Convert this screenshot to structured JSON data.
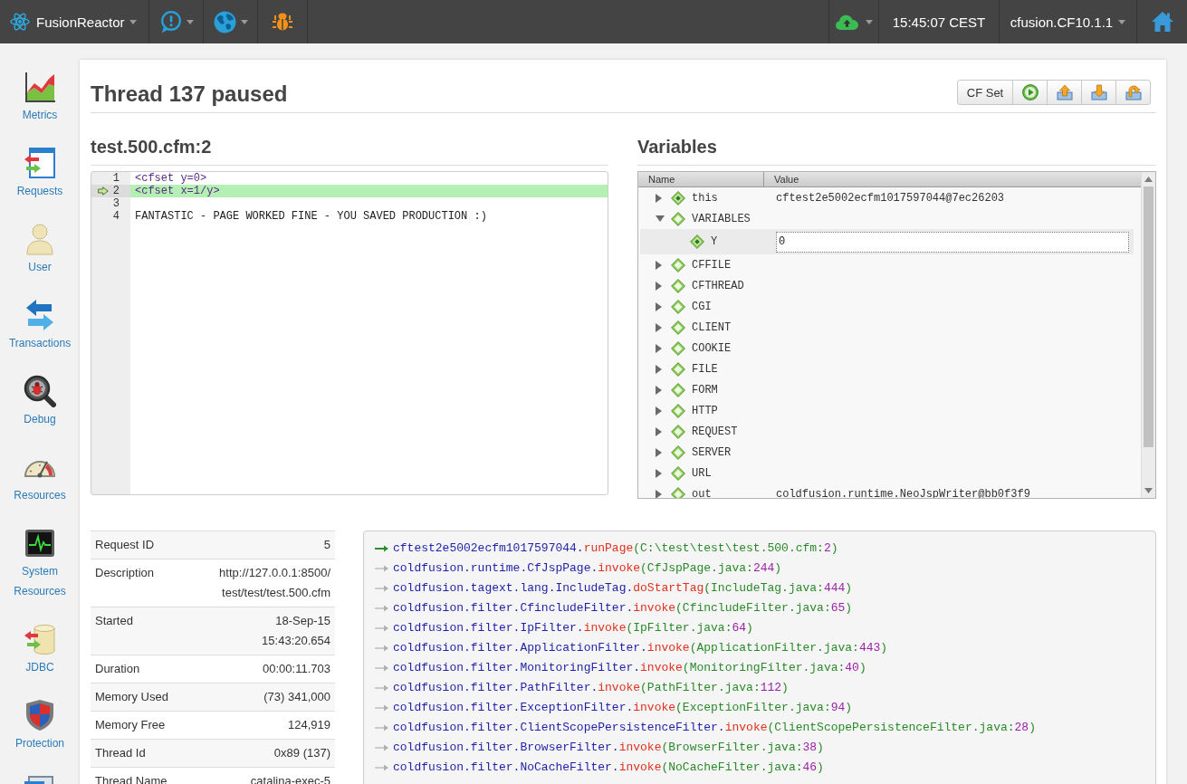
{
  "navbar": {
    "left": [
      {
        "kind": "brand",
        "label": "FusionReactor",
        "dropdown": true
      },
      {
        "kind": "alerts",
        "dropdown": true
      },
      {
        "kind": "globe",
        "dropdown": true
      },
      {
        "kind": "bug",
        "dropdown": false
      }
    ],
    "right": [
      {
        "kind": "cloud",
        "dropdown": true
      },
      {
        "kind": "time",
        "label": "15:45:07 CEST",
        "dropdown": false
      },
      {
        "kind": "server",
        "label": "cfusion.CF10.1.1",
        "dropdown": true
      },
      {
        "kind": "home",
        "dropdown": false
      }
    ]
  },
  "sidebar": {
    "items": [
      {
        "kind": "metrics",
        "label": "Metrics"
      },
      {
        "kind": "requests",
        "label": "Requests"
      },
      {
        "kind": "user",
        "label": "User"
      },
      {
        "kind": "transactions",
        "label": "Transactions"
      },
      {
        "kind": "debug",
        "label": "Debug"
      },
      {
        "kind": "resources",
        "label": "Resources"
      },
      {
        "kind": "system",
        "label": "System Resources"
      },
      {
        "kind": "jdbc",
        "label": "JDBC"
      },
      {
        "kind": "protection",
        "label": "Protection"
      },
      {
        "kind": "window"
      }
    ]
  },
  "page": {
    "title": "Thread 137 paused",
    "toolbar": [
      {
        "kind": "text",
        "label": "CF Set"
      },
      {
        "kind": "resume"
      },
      {
        "kind": "step-out"
      },
      {
        "kind": "step-into"
      },
      {
        "kind": "step-over"
      }
    ]
  },
  "source": {
    "title": "test.500.cfm:2",
    "lines": [
      {
        "number": "1",
        "text": "<cfset y=0>",
        "kind": "tag",
        "current": false
      },
      {
        "number": "2",
        "text": "<cfset x=1/y>",
        "kind": "tag",
        "current": true
      },
      {
        "number": "3",
        "kind": "text",
        "current": false
      },
      {
        "number": "4",
        "text": "FANTASTIC - PAGE WORKED FINE - YOU SAVED PRODUCTION :)",
        "kind": "text",
        "current": false
      }
    ]
  },
  "variables": {
    "title": "Variables",
    "columns": [
      "Name",
      "Value"
    ],
    "nodes": [
      {
        "name": "this",
        "kind": "object",
        "value": "cftest2e5002ecfm1017597044@7ec26203",
        "expanded": false,
        "selected": false
      },
      {
        "name": "VARIABLES",
        "kind": "scope",
        "expanded": true,
        "selected": false,
        "children": [
          {
            "name": "Y",
            "kind": "object",
            "value": "0",
            "selected": true
          }
        ]
      },
      {
        "name": "CFFILE",
        "kind": "scope",
        "expanded": false,
        "selected": false
      },
      {
        "name": "CFTHREAD",
        "kind": "scope",
        "expanded": false,
        "selected": false
      },
      {
        "name": "CGI",
        "kind": "scope",
        "expanded": false,
        "selected": false
      },
      {
        "name": "CLIENT",
        "kind": "scope",
        "expanded": false,
        "selected": false
      },
      {
        "name": "COOKIE",
        "kind": "scope",
        "expanded": false,
        "selected": false
      },
      {
        "name": "FILE",
        "kind": "scope",
        "expanded": false,
        "selected": false
      },
      {
        "name": "FORM",
        "kind": "scope",
        "expanded": false,
        "selected": false
      },
      {
        "name": "HTTP",
        "kind": "scope",
        "expanded": false,
        "selected": false
      },
      {
        "name": "REQUEST",
        "kind": "scope",
        "expanded": false,
        "selected": false
      },
      {
        "name": "SERVER",
        "kind": "scope",
        "expanded": false,
        "selected": false
      },
      {
        "name": "URL",
        "kind": "scope",
        "expanded": false,
        "selected": false
      },
      {
        "name": "out",
        "kind": "scope",
        "value": "coldfusion.runtime.NeoJspWriter@bb0f3f9",
        "expanded": false,
        "selected": false
      }
    ]
  },
  "request_info": {
    "rows": [
      {
        "label": "Request ID",
        "value": "5"
      },
      {
        "label": "Description",
        "value_lines": [
          "http://127.0.0.1:8500/",
          "test/test/test.500.cfm"
        ]
      },
      {
        "label": "Started",
        "value_lines": [
          "18-Sep-15",
          "15:43:20.654"
        ]
      },
      {
        "label": "Duration",
        "value": "00:00:11.703"
      },
      {
        "label": "Memory Used",
        "value": "(73) 341,000"
      },
      {
        "label": "Memory Free",
        "value": "124,919"
      },
      {
        "label": "Thread Id",
        "value": "0x89 (137)"
      },
      {
        "label": "Thread Name",
        "value": "catalina-exec-5"
      }
    ]
  },
  "stack_trace": {
    "frames": [
      {
        "current": true,
        "class": "cftest2e5002ecfm1017597044.",
        "method": "runPage",
        "source": "(C:\\test\\test\\test.500.cfm:",
        "line": "2",
        "end": ")"
      },
      {
        "current": false,
        "class": "coldfusion.runtime.CfJspPage.",
        "method": "invoke",
        "source": "(CfJspPage.java:",
        "line": "244",
        "end": ")"
      },
      {
        "current": false,
        "class": "coldfusion.tagext.lang.IncludeTag.",
        "method": "doStartTag",
        "source": "(IncludeTag.java:",
        "line": "444",
        "end": ")"
      },
      {
        "current": false,
        "class": "coldfusion.filter.CfincludeFilter.",
        "method": "invoke",
        "source": "(CfincludeFilter.java:",
        "line": "65",
        "end": ")"
      },
      {
        "current": false,
        "class": "coldfusion.filter.IpFilter.",
        "method": "invoke",
        "source": "(IpFilter.java:",
        "line": "64",
        "end": ")"
      },
      {
        "current": false,
        "class": "coldfusion.filter.ApplicationFilter.",
        "method": "invoke",
        "source": "(ApplicationFilter.java:",
        "line": "443",
        "end": ")"
      },
      {
        "current": false,
        "class": "coldfusion.filter.MonitoringFilter.",
        "method": "invoke",
        "source": "(MonitoringFilter.java:",
        "line": "40",
        "end": ")"
      },
      {
        "current": false,
        "class": "coldfusion.filter.PathFilter.",
        "method": "invoke",
        "source": "(PathFilter.java:",
        "line": "112",
        "end": ")"
      },
      {
        "current": false,
        "class": "coldfusion.filter.ExceptionFilter.",
        "method": "invoke",
        "source": "(ExceptionFilter.java:",
        "line": "94",
        "end": ")"
      },
      {
        "current": false,
        "class": "coldfusion.filter.ClientScopePersistenceFilter.",
        "method": "invoke",
        "source": "(ClientScopePersistenceFilter.java:",
        "line": "28",
        "end": ")"
      },
      {
        "current": false,
        "class": "coldfusion.filter.BrowserFilter.",
        "method": "invoke",
        "source": "(BrowserFilter.java:",
        "line": "38",
        "end": ")"
      },
      {
        "current": false,
        "class": "coldfusion.filter.NoCacheFilter.",
        "method": "invoke",
        "source": "(NoCacheFilter.java:",
        "line": "46",
        "end": ")"
      }
    ]
  }
}
